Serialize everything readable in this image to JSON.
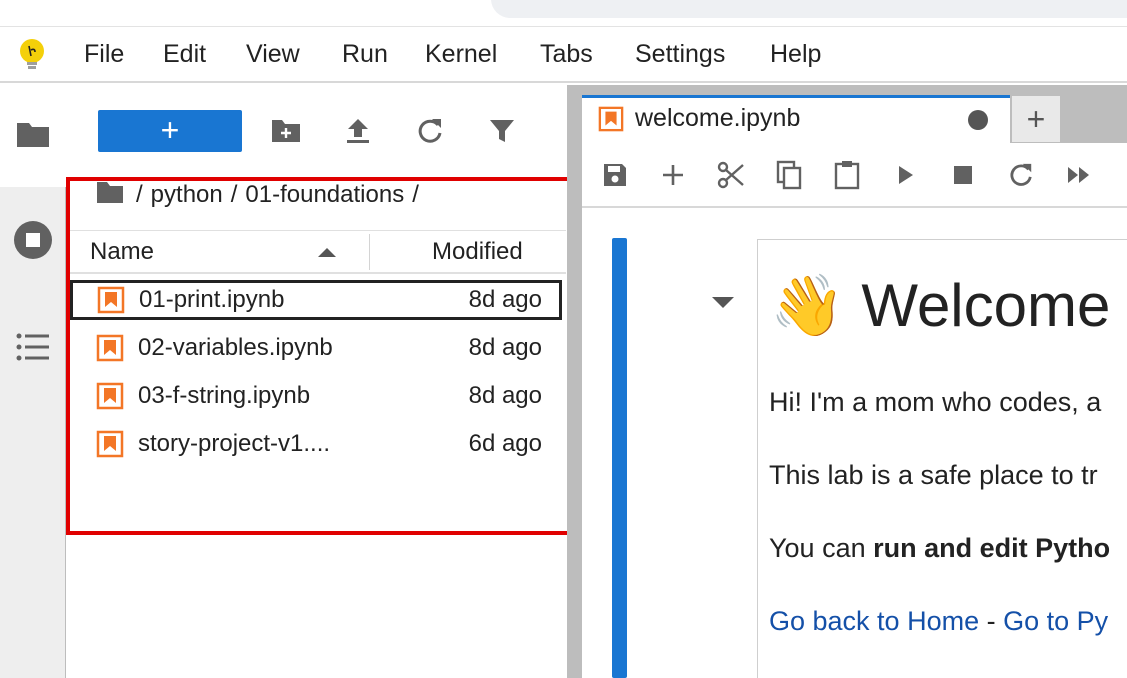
{
  "menubar": {
    "items": [
      "File",
      "Edit",
      "View",
      "Run",
      "Kernel",
      "Tabs",
      "Settings",
      "Help"
    ]
  },
  "file_browser": {
    "new_label": "+",
    "breadcrumb": [
      "/",
      "python",
      "/",
      "01-foundations",
      "/"
    ],
    "columns": {
      "name": "Name",
      "modified": "Modified"
    },
    "files": [
      {
        "name": "01-print.ipynb",
        "modified": "8d ago",
        "selected": true
      },
      {
        "name": "02-variables.ipynb",
        "modified": "8d ago",
        "selected": false
      },
      {
        "name": "03-f-string.ipynb",
        "modified": "8d ago",
        "selected": false
      },
      {
        "name": "story-project-v1....",
        "modified": "6d ago",
        "selected": false
      }
    ]
  },
  "notebook": {
    "tab_title": "welcome.ipynb",
    "add_tab_label": "+",
    "heading_emoji": "👋",
    "heading": "Welcome",
    "para1": "Hi! I'm a mom who codes, a",
    "para2": "This lab is a safe place to tr",
    "para3_prefix": "You can ",
    "para3_bold": "run and edit Pytho",
    "link_home": "Go back to Home",
    "link_sep": " - ",
    "link_py": "Go to Py"
  },
  "colors": {
    "accent": "#1976d2",
    "notebook_icon": "#f37626",
    "highlight_box": "#e00000",
    "link": "#1450a8"
  }
}
